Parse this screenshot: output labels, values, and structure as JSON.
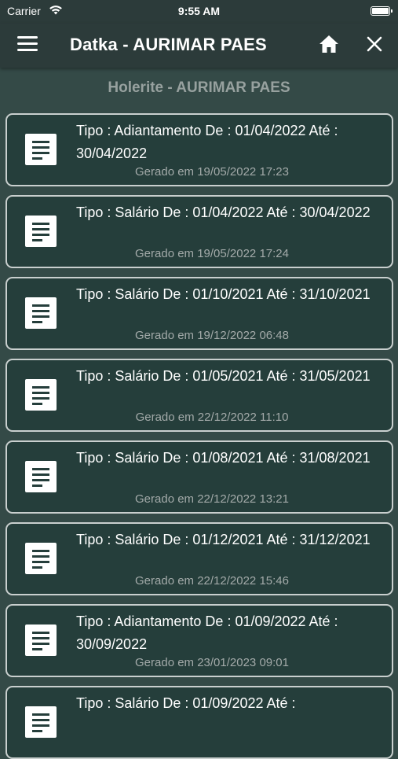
{
  "status_bar": {
    "carrier": "Carrier",
    "time": "9:55 AM"
  },
  "app_bar": {
    "title": "Datka - AURIMAR PAES"
  },
  "page": {
    "subtitle": "Holerite - AURIMAR PAES"
  },
  "payslips": [
    {
      "title": "Tipo : Adiantamento De : 01/04/2022  Até : 30/04/2022",
      "generated": "Gerado em 19/05/2022 17:23"
    },
    {
      "title": "Tipo : Salário De : 01/04/2022  Até : 30/04/2022",
      "generated": "Gerado em 19/05/2022 17:24"
    },
    {
      "title": "Tipo : Salário De : 01/10/2021  Até : 31/10/2021",
      "generated": "Gerado em 19/12/2022 06:48"
    },
    {
      "title": "Tipo : Salário De : 01/05/2021  Até : 31/05/2021",
      "generated": "Gerado em 22/12/2022 11:10"
    },
    {
      "title": "Tipo : Salário De : 01/08/2021  Até : 31/08/2021",
      "generated": "Gerado em 22/12/2022 13:21"
    },
    {
      "title": "Tipo : Salário De : 01/12/2021  Até : 31/12/2021",
      "generated": "Gerado em 22/12/2022 15:46"
    },
    {
      "title": "Tipo : Adiantamento De : 01/09/2022  Até : 30/09/2022",
      "generated": "Gerado em 23/01/2023 09:01"
    },
    {
      "title": "Tipo : Salário De : 01/09/2022  Até :",
      "generated": ""
    }
  ]
}
